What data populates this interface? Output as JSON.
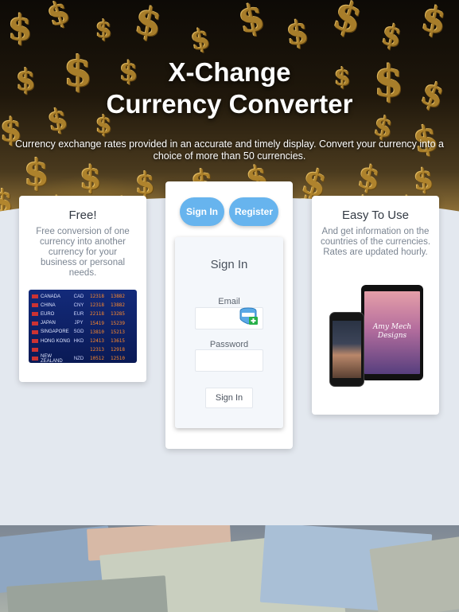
{
  "hero": {
    "title_line1": "X-Change",
    "title_line2": "Currency Converter",
    "subtitle": "Currency exchange rates provided in an accurate and timely display. Convert your currency into a choice of more than 50 currencies."
  },
  "free_card": {
    "title": "Free!",
    "description": "Free conversion of one currency into another currency for your business or personal needs.",
    "board_rows": [
      {
        "name": "CANADA",
        "code": "CAD",
        "a": "12318",
        "b": "13882"
      },
      {
        "name": "CHINA",
        "code": "CNY",
        "a": "12318",
        "b": "13882"
      },
      {
        "name": "EURO",
        "code": "EUR",
        "a": "22118",
        "b": "13285"
      },
      {
        "name": "JAPAN",
        "code": "JPY",
        "a": "15419",
        "b": "15239"
      },
      {
        "name": "SINGAPORE",
        "code": "SGD",
        "a": "13810",
        "b": "15213"
      },
      {
        "name": "HONG KONG",
        "code": "HKD",
        "a": "12413",
        "b": "13615"
      },
      {
        "name": "",
        "code": "",
        "a": "12313",
        "b": "12918"
      },
      {
        "name": "NEW ZEALAND",
        "code": "NZD",
        "a": "10512",
        "b": "12510"
      }
    ]
  },
  "auth_card": {
    "signin_tab": "Sign In",
    "register_tab": "Register",
    "form_title": "Sign In",
    "email_label": "Email",
    "email_value": "",
    "password_label": "Password",
    "password_value": "",
    "submit_label": "Sign In"
  },
  "easy_card": {
    "title": "Easy To Use",
    "description": "And get information on the countries of the currencies. Rates are updated hourly.",
    "tablet_text_line1": "Amy Mech",
    "tablet_text_line2": "Designs"
  },
  "colors": {
    "accent": "#67b4ee",
    "page_bg": "#e3e8ef",
    "card_bg": "#ffffff"
  },
  "icons": [
    "dollar-sign-icon",
    "password-manager-icon",
    "flag-icon"
  ]
}
